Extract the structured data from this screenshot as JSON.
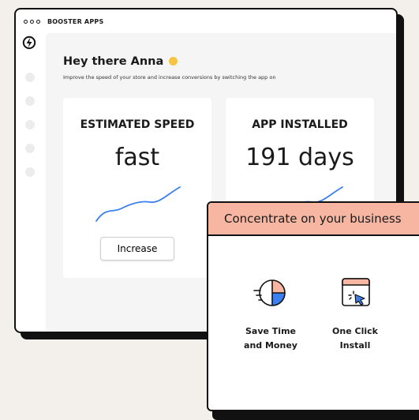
{
  "app": {
    "title": "BOOSTER APPS"
  },
  "dashboard": {
    "greeting": "Hey there Anna",
    "subtitle": "Improve the speed of your store and increase conversions by switching the app on",
    "cards": [
      {
        "title": "ESTIMATED SPEED",
        "value": "fast",
        "button": "Increase"
      },
      {
        "title": "APP INSTALLED",
        "value": "191 days"
      }
    ]
  },
  "popup": {
    "title": "Concentrate on your business",
    "features": [
      {
        "line1": "Save Time",
        "line2": "and Money",
        "icon": "clock-pie-icon"
      },
      {
        "line1": "One Click",
        "line2": "Install",
        "icon": "click-window-icon"
      }
    ]
  },
  "colors": {
    "accent_blue": "#3b7ff0",
    "popup_header": "#f7b6a1",
    "page_background": "#f3f0eb"
  }
}
